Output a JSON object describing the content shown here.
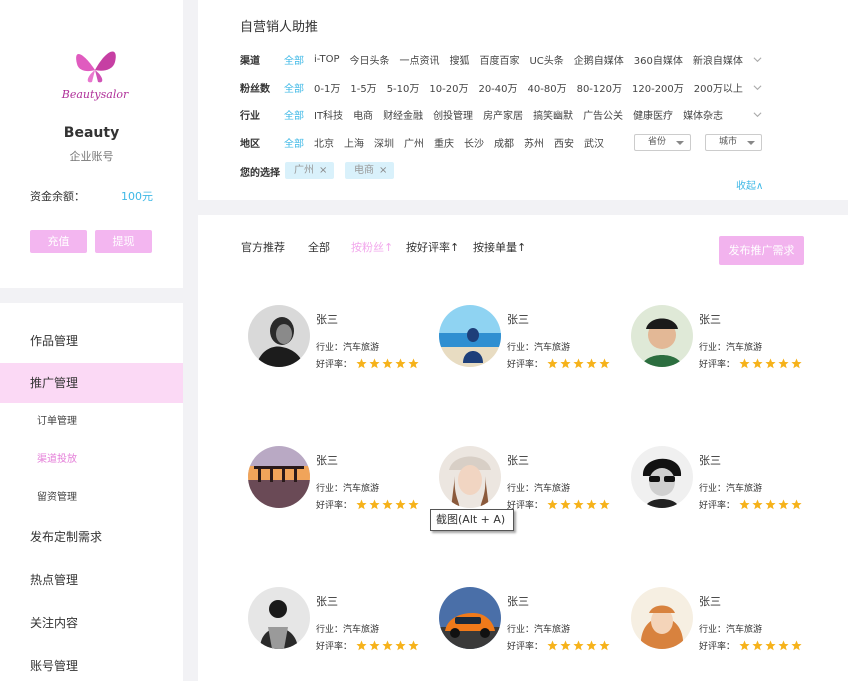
{
  "sidebar": {
    "brand": "Beauty",
    "account_type": "企业账号",
    "balance_label": "资金余额：",
    "balance_value": "100元",
    "recharge": "充值",
    "withdraw": "提现",
    "logo_text": "Beautysalor",
    "nav": {
      "works": "作品管理",
      "promo": "推广管理",
      "orders": "订单管理",
      "channel": "渠道投放",
      "comments": "留资管理",
      "custom": "发布定制需求",
      "hotspot": "热点管理",
      "follow": "关注内容",
      "account": "账号管理"
    }
  },
  "filter": {
    "title": "自营销人助推",
    "rows": [
      {
        "label": "渠道",
        "options": [
          "全部",
          "i-TOP",
          "今日头条",
          "一点资讯",
          "搜狐",
          "百度百家",
          "UC头条",
          "企鹅自媒体",
          "360自媒体",
          "新浪自媒体"
        ]
      },
      {
        "label": "粉丝数",
        "options": [
          "全部",
          "0-1万",
          "1-5万",
          "5-10万",
          "10-20万",
          "20-40万",
          "40-80万",
          "80-120万",
          "120-200万",
          "200万以上"
        ]
      },
      {
        "label": "行业",
        "options": [
          "全部",
          "IT科技",
          "电商",
          "财经金融",
          "创投管理",
          "房产家居",
          "搞笑幽默",
          "广告公关",
          "健康医疗",
          "媒体杂志"
        ]
      },
      {
        "label": "地区",
        "options": [
          "全部",
          "北京",
          "上海",
          "深圳",
          "广州",
          "重庆",
          "长沙",
          "成都",
          "苏州",
          "西安",
          "武汉"
        ]
      }
    ],
    "province": "省份",
    "city": "城市",
    "your_choice": "您的选择",
    "tags": [
      "广州",
      "电商"
    ],
    "collapse": "收起∧"
  },
  "sort": {
    "official": "官方推荐",
    "all": "全部",
    "by_fans": "按粉丝↑",
    "by_rating": "按好评率↑",
    "by_orders": "按接单量↑",
    "publish": "发布推广需求"
  },
  "cards": [
    {
      "name": "张三",
      "industry": "行业：汽车旅游",
      "rating_label": "好评率：",
      "stars": 5,
      "avatar": "bw-man-avatar"
    },
    {
      "name": "张三",
      "industry": "行业：汽车旅游",
      "rating_label": "好评率：",
      "stars": 5,
      "avatar": "beach-person-avatar"
    },
    {
      "name": "张三",
      "industry": "行业：汽车旅游",
      "rating_label": "好评率：",
      "stars": 5,
      "avatar": "boy-cap-avatar"
    },
    {
      "name": "张三",
      "industry": "行业：汽车旅游",
      "rating_label": "好评率：",
      "stars": 5,
      "avatar": "sunset-pier-avatar"
    },
    {
      "name": "张三",
      "industry": "行业：汽车旅游",
      "rating_label": "好评率：",
      "stars": 5,
      "avatar": "girl-hat-avatar"
    },
    {
      "name": "张三",
      "industry": "行业：汽车旅游",
      "rating_label": "好评率：",
      "stars": 5,
      "avatar": "sunglasses-man-avatar"
    },
    {
      "name": "张三",
      "industry": "行业：汽车旅游",
      "rating_label": "好评率：",
      "stars": 5,
      "avatar": "bw-woman-avatar"
    },
    {
      "name": "张三",
      "industry": "行业：汽车旅游",
      "rating_label": "好评率：",
      "stars": 5,
      "avatar": "orange-car-avatar"
    },
    {
      "name": "张三",
      "industry": "行业：汽车旅游",
      "rating_label": "好评率：",
      "stars": 5,
      "avatar": "redhead-girl-avatar"
    }
  ],
  "tooltip": "截图(Alt + A)",
  "colors": {
    "accent_blue": "#3eb8e6",
    "pink": "#f3b6f0",
    "star": "#f6b21a",
    "active_nav_bg": "#fbd9f5"
  }
}
